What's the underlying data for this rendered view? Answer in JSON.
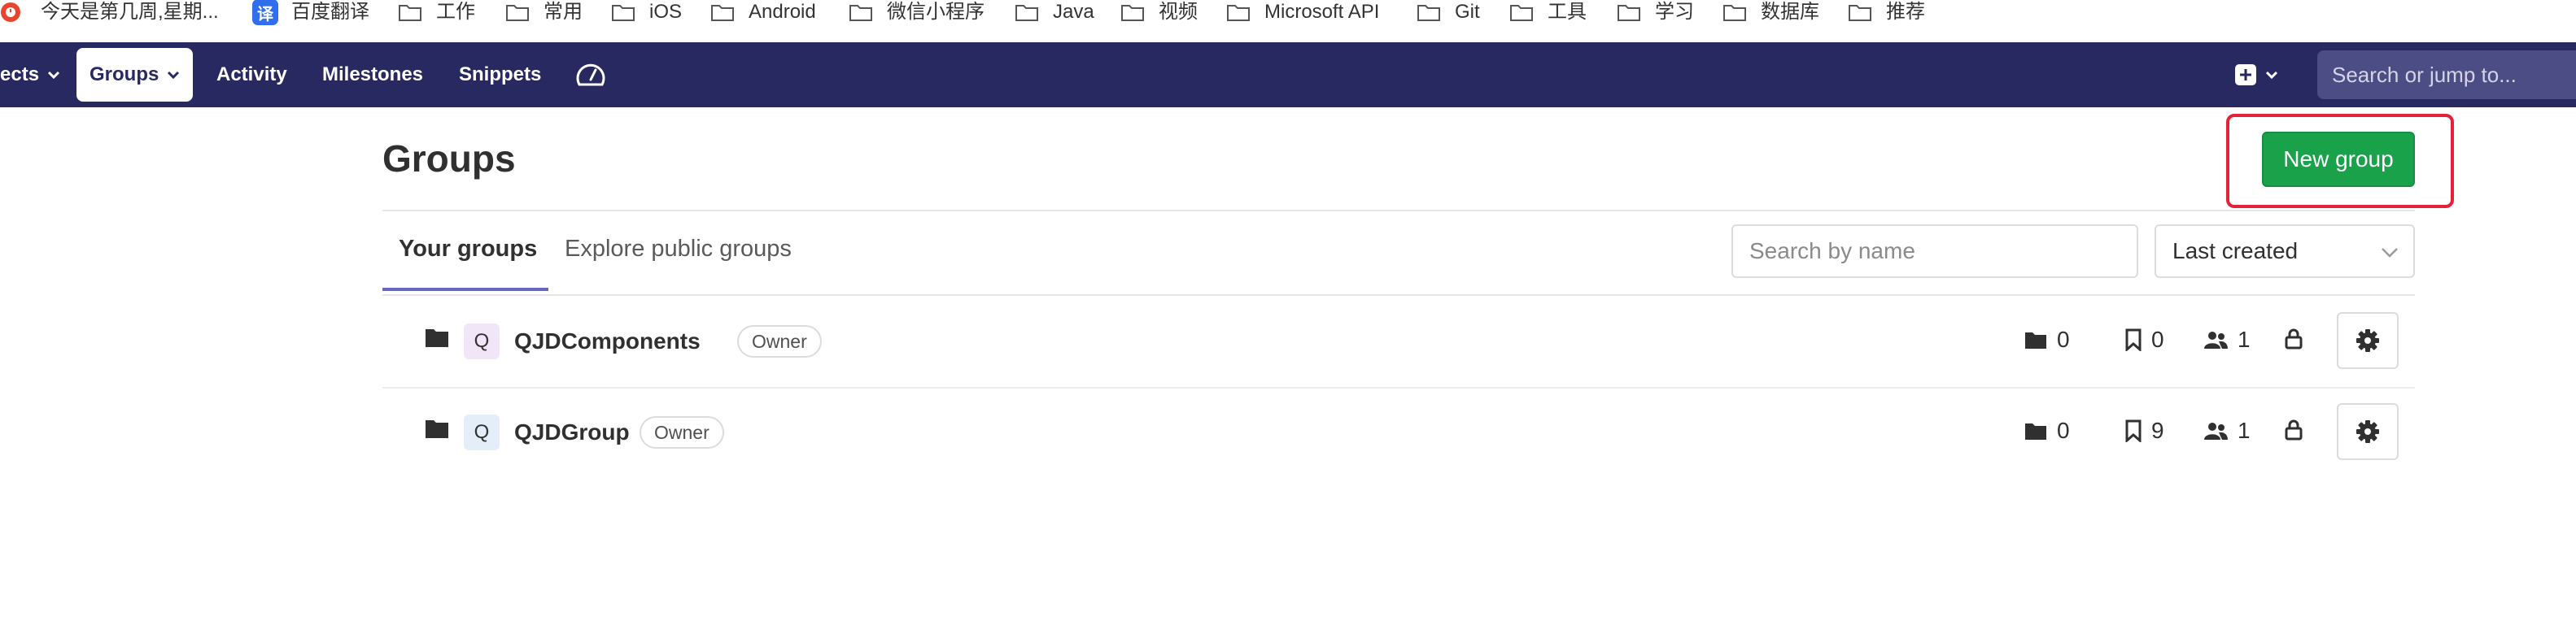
{
  "bookmarks": [
    {
      "label": "今天是第几周,星期...",
      "icon": "clock-app-icon"
    },
    {
      "label": "百度翻译",
      "icon": "translate-app-icon",
      "badge": "译"
    },
    {
      "label": "工作",
      "icon": "folder-icon"
    },
    {
      "label": "常用",
      "icon": "folder-icon"
    },
    {
      "label": "iOS",
      "icon": "folder-icon"
    },
    {
      "label": "Android",
      "icon": "folder-icon"
    },
    {
      "label": "微信小程序",
      "icon": "folder-icon"
    },
    {
      "label": "Java",
      "icon": "folder-icon"
    },
    {
      "label": "视频",
      "icon": "folder-icon"
    },
    {
      "label": "Microsoft API",
      "icon": "folder-icon"
    },
    {
      "label": "Git",
      "icon": "folder-icon"
    },
    {
      "label": "工具",
      "icon": "folder-icon"
    },
    {
      "label": "学习",
      "icon": "folder-icon"
    },
    {
      "label": "数据库",
      "icon": "folder-icon"
    },
    {
      "label": "推荐",
      "icon": "folder-icon"
    }
  ],
  "navbar": {
    "projects_label": "ects",
    "groups_label": "Groups",
    "activity_label": "Activity",
    "milestones_label": "Milestones",
    "snippets_label": "Snippets",
    "search_placeholder": "Search or jump to...",
    "bg_color": "#292961"
  },
  "page": {
    "title": "Groups",
    "new_group_label": "New group",
    "new_group_color": "#1aa24b",
    "highlight_color": "#e5213a"
  },
  "tabs": {
    "active_label": "Your groups",
    "inactive_label": "Explore public groups"
  },
  "filters": {
    "search_placeholder": "Search by name",
    "sort_value": "Last created"
  },
  "groups": [
    {
      "avatar_letter": "Q",
      "name": "QJDComponents",
      "role": "Owner",
      "subgroups": "0",
      "projects": "0",
      "members": "1",
      "visibility": "private"
    },
    {
      "avatar_letter": "Q",
      "name": "QJDGroup",
      "role": "Owner",
      "subgroups": "0",
      "projects": "9",
      "members": "1",
      "visibility": "private"
    }
  ]
}
